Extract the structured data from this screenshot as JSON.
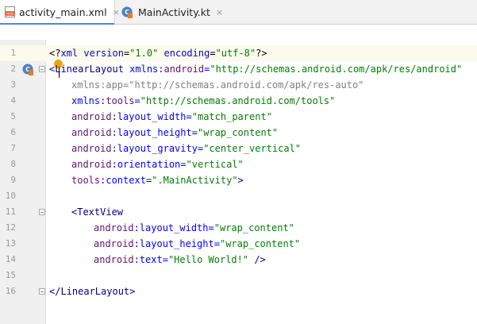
{
  "tabs": [
    {
      "label": "activity_main.xml",
      "close": "×",
      "icon": "xml-file-icon",
      "active": true
    },
    {
      "label": "MainActivity.kt",
      "close": "×",
      "icon": "kotlin-file-icon",
      "active": false
    }
  ],
  "gutter": {
    "line_numbers": [
      "1",
      "2",
      "3",
      "4",
      "5",
      "6",
      "7",
      "8",
      "9",
      "10",
      "11",
      "12",
      "13",
      "14",
      "15",
      "16"
    ]
  },
  "code": {
    "l1": {
      "open": "<?",
      "tag": "xml",
      "a1": " version",
      "e1": "=",
      "v1": "\"1.0\"",
      "a2": " encoding",
      "e2": "=",
      "v2": "\"utf-8\"",
      "close": "?>"
    },
    "l2": {
      "open": "<",
      "tag": "LinearLayout",
      "ns": " xmlns",
      "colon": ":",
      "attr": "android",
      "eq": "=",
      "val": "\"http://schemas.android.com/apk/res/android\""
    },
    "l3": {
      "text": "xmlns:app=\"http://schemas.android.com/apk/res-auto\""
    },
    "l4": {
      "ns": "xmlns",
      "colon": ":",
      "attr": "tools",
      "eq": "=",
      "val": "\"http://schemas.android.com/tools\""
    },
    "l5": {
      "ns": "android",
      "colon": ":",
      "attr": "layout_width",
      "eq": "=",
      "val": "\"match_parent\""
    },
    "l6": {
      "ns": "android",
      "colon": ":",
      "attr": "layout_height",
      "eq": "=",
      "val": "\"wrap_content\""
    },
    "l7": {
      "ns": "android",
      "colon": ":",
      "attr": "layout_gravity",
      "eq": "=",
      "val": "\"center_vertical\""
    },
    "l8": {
      "ns": "android",
      "colon": ":",
      "attr": "orientation",
      "eq": "=",
      "val": "\"vertical\""
    },
    "l9": {
      "ns": "tools",
      "colon": ":",
      "attr": "context",
      "eq": "=",
      "val": "\".MainActivity\"",
      "close": ">"
    },
    "l11": {
      "open": "<",
      "tag": "TextView"
    },
    "l12": {
      "ns": "android",
      "colon": ":",
      "attr": "layout_width",
      "eq": "=",
      "val": "\"wrap_content\""
    },
    "l13": {
      "ns": "android",
      "colon": ":",
      "attr": "layout_height",
      "eq": "=",
      "val": "\"wrap_content\""
    },
    "l14": {
      "ns": "android",
      "colon": ":",
      "attr": "text",
      "eq": "=",
      "val": "\"Hello World!\"",
      "close": " />"
    },
    "l16": {
      "open": "</",
      "tag": "LinearLayout",
      "close": ">"
    }
  },
  "colors": {
    "tag": "#000080",
    "attribute": "#0000ff",
    "namespace": "#660e7a",
    "value": "#008000",
    "tab_accent": "#4a89dc"
  }
}
